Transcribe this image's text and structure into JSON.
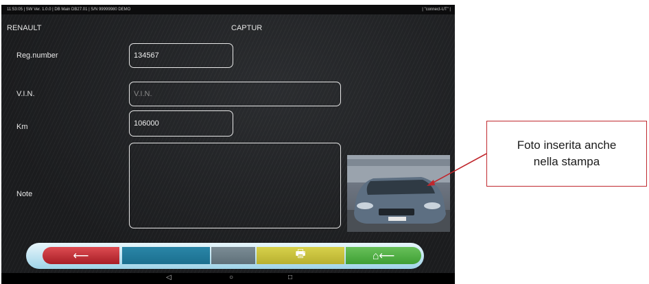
{
  "status_bar": {
    "left_text": "11:53:05  |  SW Ver. 1.0.0  |  DB Main DB27.01  |  S/N 99999980 DEMO",
    "right_text": "|  \"connect-UT\"  |"
  },
  "header": {
    "make": "RENAULT",
    "model": "CAPTUR"
  },
  "form": {
    "reg_number": {
      "label": "Reg.number",
      "value": "134567"
    },
    "vin": {
      "label": "V.I.N.",
      "placeholder": "V.I.N."
    },
    "km": {
      "label": "Km",
      "value": "106000"
    },
    "note": {
      "label": "Note",
      "value": ""
    }
  },
  "photo": {
    "alt": "car photo"
  },
  "toolbar": {
    "back_icon": "back-arrow-icon",
    "print_icon": "printer-icon",
    "home_icon": "home-back-icon",
    "back_glyph": "⟵",
    "print_glyph": "🖶",
    "home_glyph": "⌂⟵"
  },
  "android_nav": {
    "back": "◁",
    "home": "○",
    "recent": "□"
  },
  "callout": {
    "line1": "Foto inserita anche",
    "line2": "nella stampa"
  },
  "colors": {
    "callout_border": "#c0272d",
    "back": "#c7303a",
    "print": "#cbc23e",
    "home": "#55b348",
    "bar": "#2380a3"
  }
}
